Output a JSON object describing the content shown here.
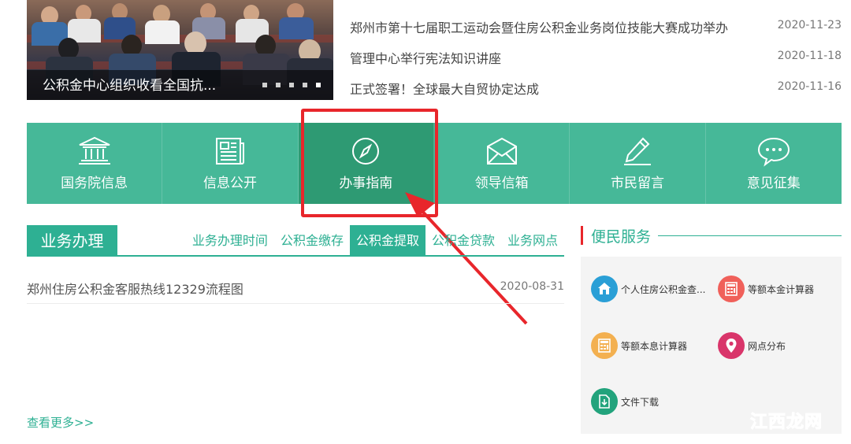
{
  "slider": {
    "caption": "公积金中心组织收看全国抗...",
    "dot_count": 5,
    "active_dot": 4
  },
  "news": [
    {
      "title": "郑州市第十七届职工运动会暨住房公积金业务岗位技能大赛成功举办",
      "date": "2020-11-23"
    },
    {
      "title": "管理中心举行宪法知识讲座",
      "date": "2020-11-18"
    },
    {
      "title": "正式签署！全球最大自贸协定达成",
      "date": "2020-11-16"
    }
  ],
  "nav": [
    {
      "label": "国务院信息",
      "icon": "government-building-icon"
    },
    {
      "label": "信息公开",
      "icon": "newspaper-icon"
    },
    {
      "label": "办事指南",
      "icon": "compass-icon"
    },
    {
      "label": "领导信箱",
      "icon": "envelope-icon"
    },
    {
      "label": "市民留言",
      "icon": "pencil-icon"
    },
    {
      "label": "意见征集",
      "icon": "chat-bubble-icon"
    }
  ],
  "nav_active": 2,
  "business": {
    "title": "业务办理",
    "tabs": [
      "业务办理时间",
      "公积金缴存",
      "公积金提取",
      "公积金贷款",
      "业务网点"
    ],
    "active_tab": 2,
    "rows": [
      {
        "title": "郑州住房公积金客服热线12329流程图",
        "date": "2020-08-31"
      }
    ],
    "more": "查看更多>>"
  },
  "services": {
    "title": "便民服务",
    "items": [
      {
        "name": "个人住房公积金查...",
        "icon": "house-icon",
        "color": "#2a9fd6"
      },
      {
        "name": "等额本金计算器",
        "icon": "calculator-icon",
        "color": "#f0605a"
      },
      {
        "name": "等额本息计算器",
        "icon": "calculator-icon",
        "color": "#f3b050"
      },
      {
        "name": "网点分布",
        "icon": "location-pin-icon",
        "color": "#d9356a"
      },
      {
        "name": "文件下载",
        "icon": "download-file-icon",
        "color": "#22a37c"
      }
    ]
  },
  "watermark": {
    "text": "江西龙网"
  },
  "colors": {
    "green": "#46b898",
    "green_dark": "#2e9a73",
    "accent": "#2eb093",
    "highlight": "#e8262b"
  }
}
